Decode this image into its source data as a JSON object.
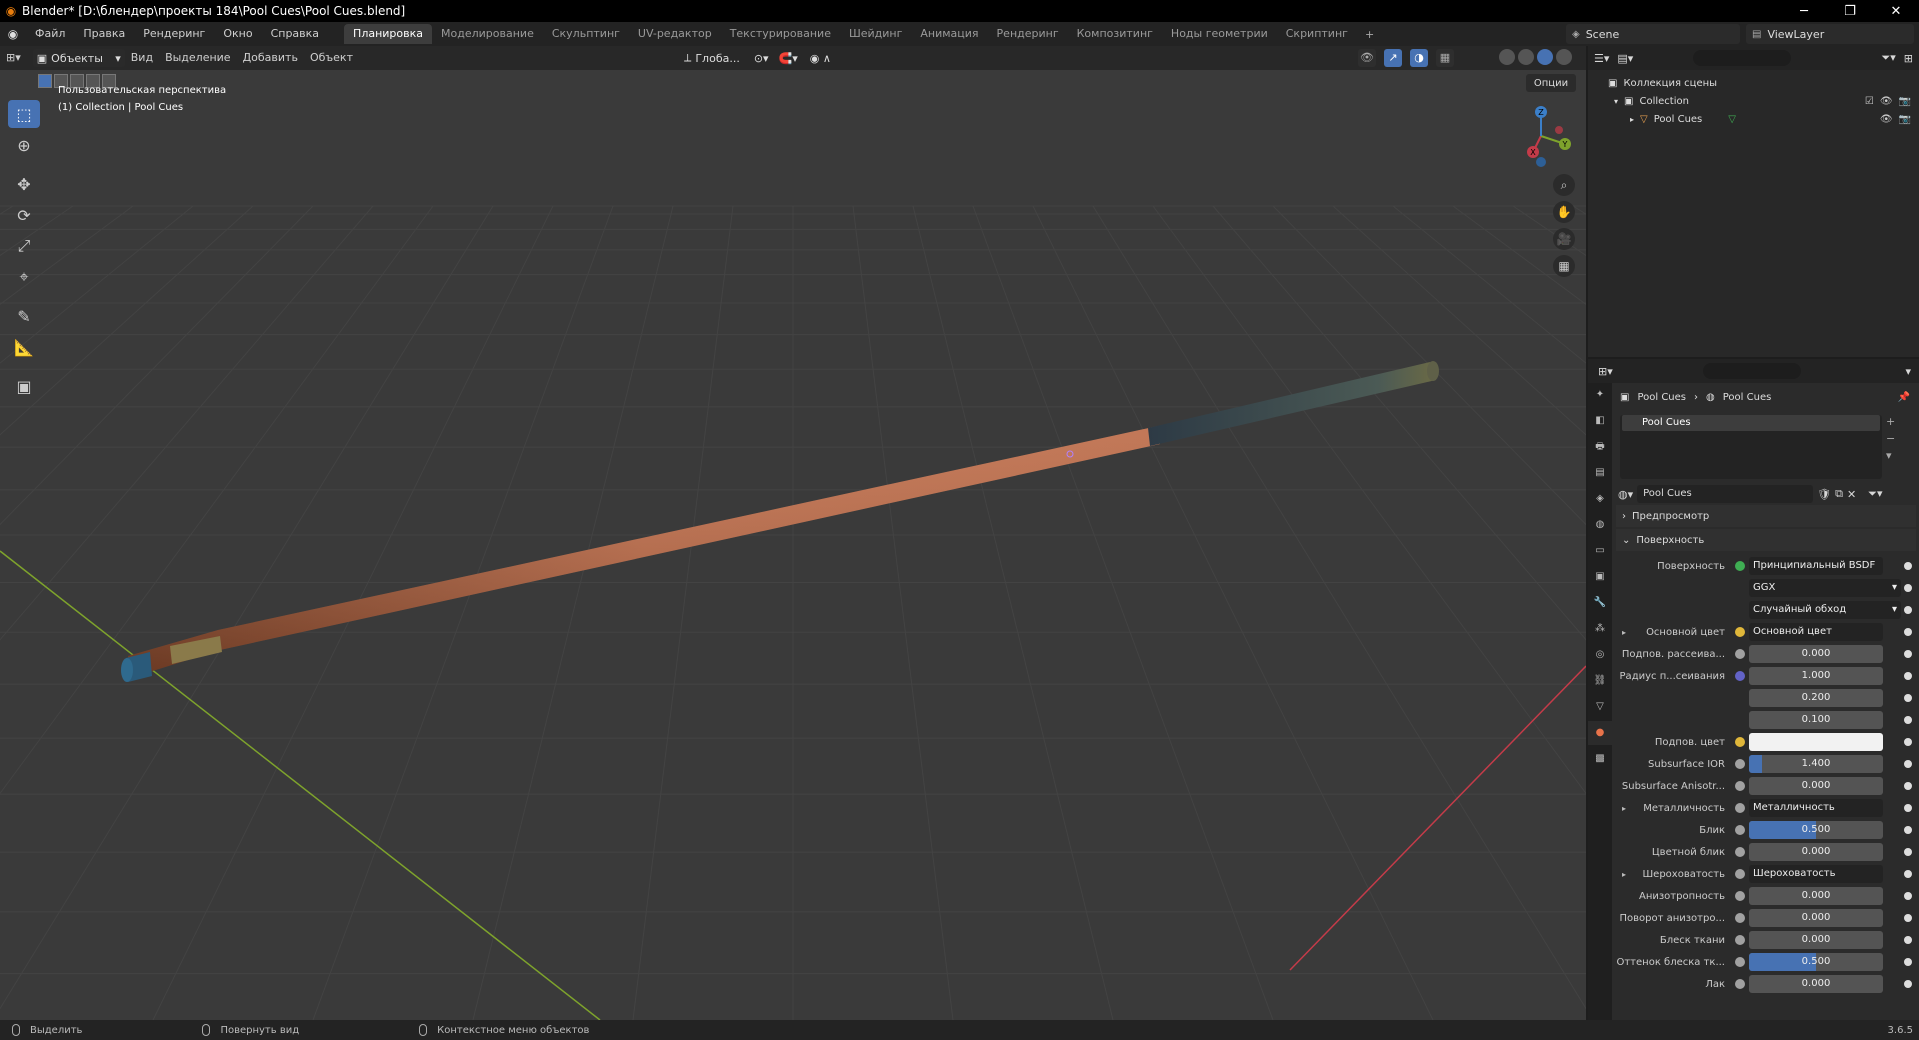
{
  "window": {
    "title": "Blender* [D:\\блендер\\проекты 184\\Pool Cues\\Pool Cues.blend]",
    "minimize": "─",
    "maximize": "❐",
    "close": "✕"
  },
  "menu": {
    "file": "Файл",
    "edit": "Правка",
    "render": "Рендеринг",
    "window": "Окно",
    "help": "Справка"
  },
  "workspaces": [
    "Планировка",
    "Моделирование",
    "Скульптинг",
    "UV-редактор",
    "Текстурирование",
    "Шейдинг",
    "Анимация",
    "Рендеринг",
    "Композитинг",
    "Ноды геометрии",
    "Скриптинг"
  ],
  "scene": "Scene",
  "view_layer": "ViewLayer",
  "viewport": {
    "mode": "Объекты",
    "menus": {
      "view": "Вид",
      "select": "Выделение",
      "add": "Добавить",
      "object": "Объект"
    },
    "transform": "Глоба...",
    "options": "Опции",
    "info_line1": "Пользовательская перспектива",
    "info_line2": "(1) Collection | Pool Cues",
    "gizmo": {
      "x": "X",
      "y": "Y",
      "z": "Z"
    }
  },
  "outliner": {
    "scene_collection": "Коллекция сцены",
    "collection": "Collection",
    "object": "Pool Cues"
  },
  "properties": {
    "breadcrumb_object": "Pool Cues",
    "breadcrumb_material": "Pool Cues",
    "slot": "Pool Cues",
    "material_name": "Pool Cues",
    "panel_preview": "Предпросмотр",
    "panel_surface": "Поверхность",
    "rows": [
      {
        "label": "Поверхность",
        "kind": "link",
        "value": "Принципиальный BSDF",
        "dot": "#3fae53"
      },
      {
        "label": "",
        "kind": "dd",
        "value": "GGX"
      },
      {
        "label": "",
        "kind": "dd",
        "value": "Случайный обход"
      },
      {
        "label": "Основной цвет",
        "kind": "link",
        "value": "Основной цвет",
        "dot": "#e0b73a",
        "arrow": true
      },
      {
        "label": "Подпов. рассеива...",
        "kind": "num",
        "value": "0.000",
        "dot": "#a1a1a1",
        "fill": 0
      },
      {
        "label": "Радиус п...сеивания",
        "kind": "num",
        "value": "1.000",
        "dot": "#6363c7",
        "fill": 0
      },
      {
        "label": "",
        "kind": "sub",
        "value": "0.200",
        "fill": 0
      },
      {
        "label": "",
        "kind": "sub",
        "value": "0.100",
        "fill": 0
      },
      {
        "label": "Подпов. цвет",
        "kind": "white",
        "value": "",
        "dot": "#e0b73a"
      },
      {
        "label": "Subsurface IOR",
        "kind": "num",
        "value": "1.400",
        "dot": "#a1a1a1",
        "fill": 0.1
      },
      {
        "label": "Subsurface Anisotr...",
        "kind": "num",
        "value": "0.000",
        "dot": "#a1a1a1",
        "fill": 0
      },
      {
        "label": "Металличность",
        "kind": "link",
        "value": "Металличность",
        "dot": "#a1a1a1",
        "arrow": true
      },
      {
        "label": "Блик",
        "kind": "num",
        "value": "0.500",
        "dot": "#a1a1a1",
        "fill": 0.5
      },
      {
        "label": "Цветной блик",
        "kind": "num",
        "value": "0.000",
        "dot": "#a1a1a1",
        "fill": 0
      },
      {
        "label": "Шероховатость",
        "kind": "link",
        "value": "Шероховатость",
        "dot": "#a1a1a1",
        "arrow": true
      },
      {
        "label": "Анизотропность",
        "kind": "num",
        "value": "0.000",
        "dot": "#a1a1a1",
        "fill": 0
      },
      {
        "label": "Поворот анизотро...",
        "kind": "num",
        "value": "0.000",
        "dot": "#a1a1a1",
        "fill": 0
      },
      {
        "label": "Блеск ткани",
        "kind": "num",
        "value": "0.000",
        "dot": "#a1a1a1",
        "fill": 0
      },
      {
        "label": "Оттенок блеска тк...",
        "kind": "num",
        "value": "0.500",
        "dot": "#a1a1a1",
        "fill": 0.5
      },
      {
        "label": "Лак",
        "kind": "num",
        "value": "0.000",
        "dot": "#a1a1a1",
        "fill": 0
      }
    ]
  },
  "status": {
    "select": "Выделить",
    "rotate": "Повернуть вид",
    "context": "Контекстное меню объектов",
    "version": "3.6.5"
  },
  "colors": {
    "accent": "#4772b3",
    "x_axis": "#c43b49",
    "y_axis": "#7ea32c",
    "z_axis": "#3b7fc9"
  }
}
